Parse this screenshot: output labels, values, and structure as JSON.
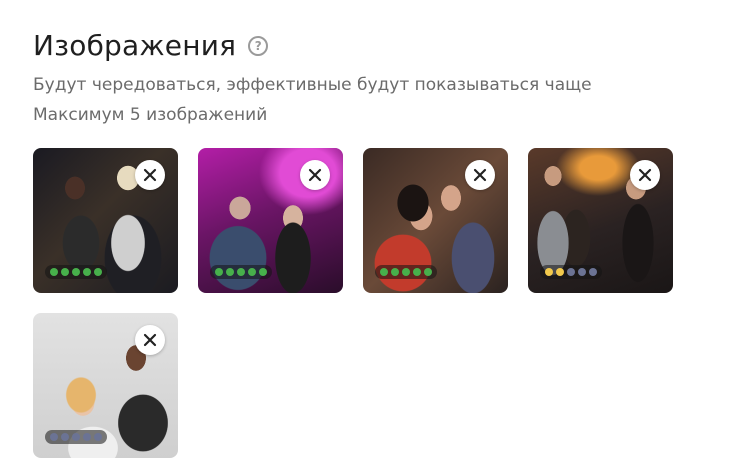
{
  "header": {
    "title": "Изображения",
    "help_icon": "question-circle-icon",
    "hint_rotation": "Будут чередоваться, эффективные будут показываться чаще",
    "hint_max": "Максимум 5 изображений"
  },
  "images": [
    {
      "rating": [
        "#47b04b",
        "#47b04b",
        "#47b04b",
        "#47b04b",
        "#47b04b"
      ]
    },
    {
      "rating": [
        "#47b04b",
        "#47b04b",
        "#47b04b",
        "#47b04b",
        "#47b04b"
      ]
    },
    {
      "rating": [
        "#47b04b",
        "#47b04b",
        "#47b04b",
        "#47b04b",
        "#47b04b"
      ]
    },
    {
      "rating": [
        "#f2c94c",
        "#f2c94c",
        "#6b7394",
        "#6b7394",
        "#6b7394"
      ]
    },
    {
      "rating": [
        "#6b7394",
        "#6b7394",
        "#6b7394",
        "#6b7394",
        "#6b7394"
      ]
    }
  ],
  "remove_icon": "close-icon"
}
